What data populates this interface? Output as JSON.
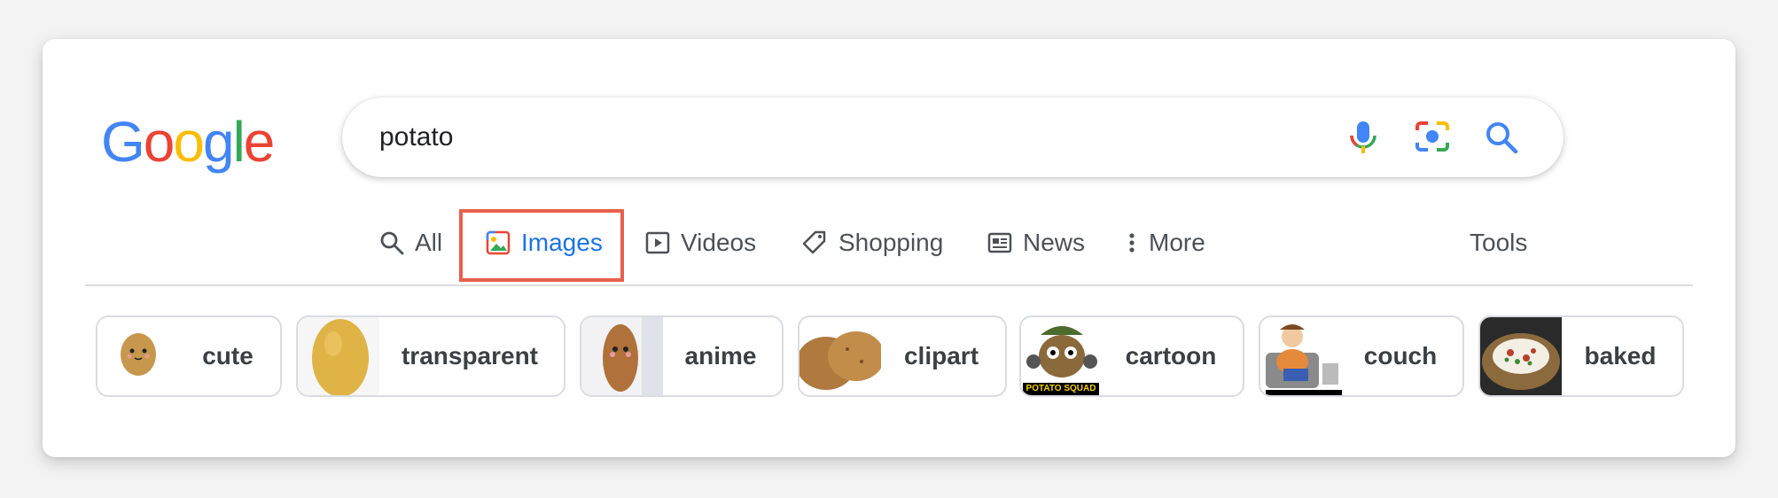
{
  "search": {
    "query": "potato"
  },
  "tabs": [
    {
      "label": "All",
      "icon": "search-icon"
    },
    {
      "label": "Images",
      "icon": "image-icon",
      "active": true
    },
    {
      "label": "Videos",
      "icon": "play-icon"
    },
    {
      "label": "Shopping",
      "icon": "tag-icon"
    },
    {
      "label": "News",
      "icon": "newspaper-icon"
    },
    {
      "label": "More",
      "icon": "more-vert-icon"
    }
  ],
  "tools_label": "Tools",
  "chips": [
    {
      "label": "cute"
    },
    {
      "label": "transparent"
    },
    {
      "label": "anime"
    },
    {
      "label": "clipart"
    },
    {
      "label": "cartoon",
      "thumb_text": "POTATO SQUAD"
    },
    {
      "label": "couch"
    },
    {
      "label": "baked"
    }
  ],
  "colors": {
    "google_blue": "#4285F4",
    "google_red": "#EA4335",
    "google_yellow": "#FBBC05",
    "google_green": "#34A853",
    "active_tab": "#1a73e8",
    "highlight_box": "#e8604c"
  }
}
